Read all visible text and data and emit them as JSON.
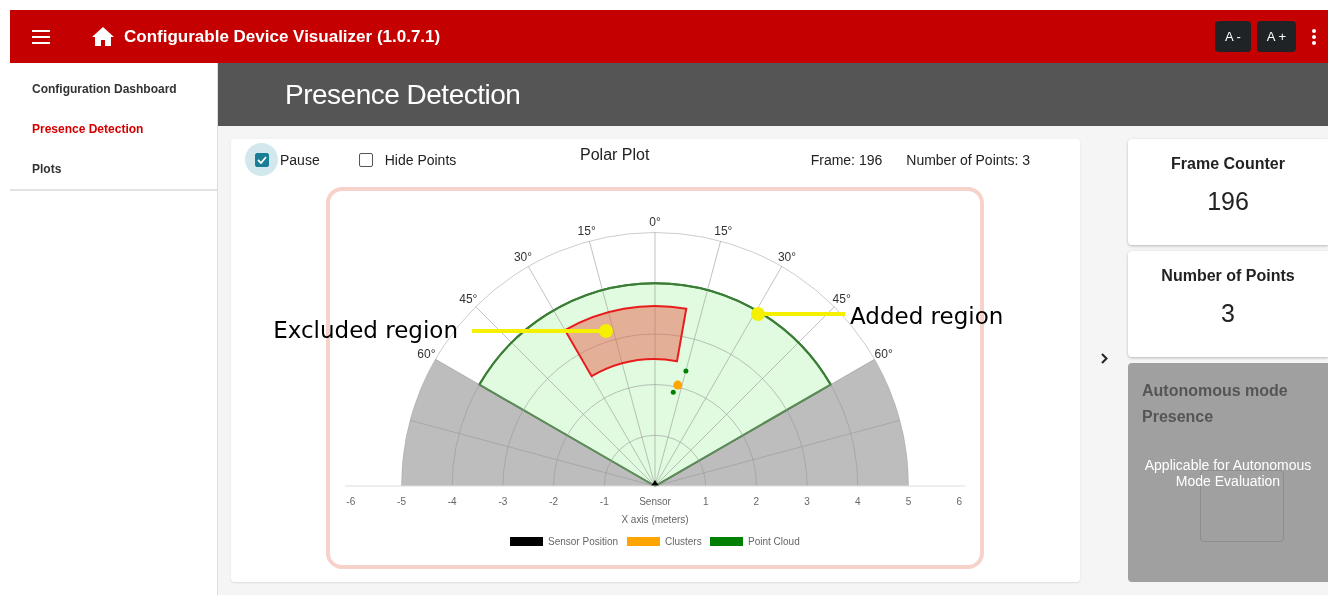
{
  "header": {
    "title": "Configurable Device Visualizer (1.0.7.1)",
    "buttons": [
      "A -",
      "A +"
    ]
  },
  "sidebar": {
    "items": [
      {
        "label": "Configuration Dashboard",
        "selected": false
      },
      {
        "label": "Presence Detection",
        "selected": true
      },
      {
        "label": "Plots",
        "selected": false
      }
    ]
  },
  "page_title": "Presence Detection",
  "plot_card": {
    "controls": [
      {
        "label": "Pause",
        "checked": true
      },
      {
        "label": "Hide Points",
        "checked": false
      }
    ],
    "title": "Polar Plot",
    "frame": "Frame: 196",
    "points": "Number of Points: 3",
    "polar_plot": {
      "angle_labels": [
        "60°",
        "45°",
        "30°",
        "15°",
        "0°",
        "15°",
        "30°",
        "45°",
        "60°"
      ],
      "x_ticks": [
        "-6",
        "-5",
        "-4",
        "-3",
        "-2",
        "-1",
        "Sensor",
        "1",
        "2",
        "3",
        "4",
        "5",
        "6"
      ],
      "xlabel": "X axis (meters)",
      "legend": [
        {
          "label": "Sensor Position",
          "color": "#000000"
        },
        {
          "label": "Clusters",
          "color": "#ffa500"
        },
        {
          "label": "Point Cloud",
          "color": "#008000"
        }
      ],
      "annotations": [
        {
          "label": "Excluded region"
        },
        {
          "label": "Added region"
        }
      ]
    }
  },
  "stats": [
    {
      "title": "Frame Counter",
      "value": "196"
    },
    {
      "title": "Number of Points",
      "value": "3"
    }
  ],
  "autonomous": {
    "title": "Autonomous mode",
    "subtitle": "Presence",
    "message": "Applicable for Autonomous Mode Evaluation"
  }
}
